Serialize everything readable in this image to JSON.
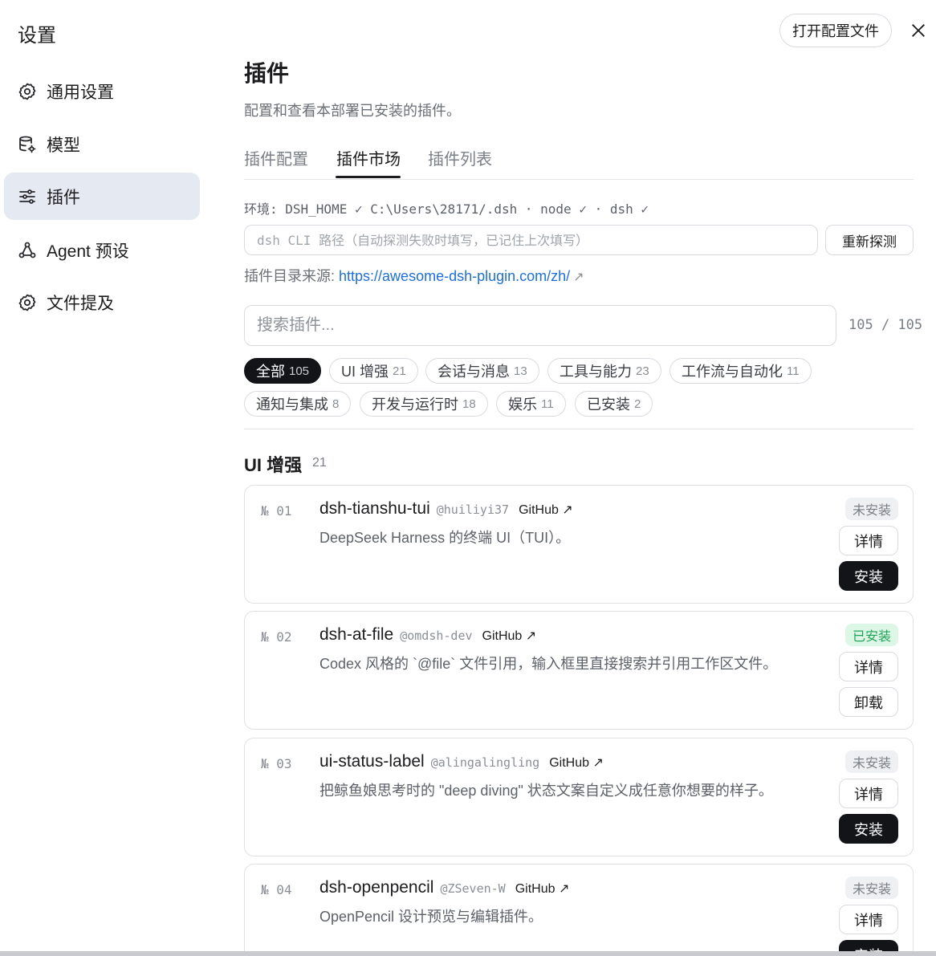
{
  "sidebar": {
    "title": "设置",
    "items": [
      {
        "label": "通用设置",
        "icon": "gear-icon"
      },
      {
        "label": "模型",
        "icon": "database-gear-icon"
      },
      {
        "label": "插件",
        "icon": "sliders-icon",
        "active": true
      },
      {
        "label": "Agent 预设",
        "icon": "network-icon"
      },
      {
        "label": "文件提及",
        "icon": "gear-icon"
      }
    ]
  },
  "header": {
    "open_config_label": "打开配置文件",
    "close_icon": "close-icon"
  },
  "page": {
    "title": "插件",
    "subtitle": "配置和查看本部署已安装的插件。"
  },
  "tabs": [
    {
      "label": "插件配置"
    },
    {
      "label": "插件市场",
      "active": true
    },
    {
      "label": "插件列表"
    }
  ],
  "env": {
    "line": "环境: DSH_HOME ✓ C:\\Users\\28171/.dsh · node ✓ · dsh ✓",
    "cli_placeholder": "dsh CLI 路径（自动探测失败时填写，已记住上次填写）",
    "redetect_label": "重新探测",
    "source_label": "插件目录来源: ",
    "source_url": "https://awesome-dsh-plugin.com/zh/",
    "source_arrow": "↗"
  },
  "search": {
    "placeholder": "搜索插件...",
    "count": "105 / 105"
  },
  "filters": [
    {
      "label": "全部",
      "count": "105",
      "active": true
    },
    {
      "label": "UI 增强",
      "count": "21"
    },
    {
      "label": "会话与消息",
      "count": "13"
    },
    {
      "label": "工具与能力",
      "count": "23"
    },
    {
      "label": "工作流与自动化",
      "count": "11"
    },
    {
      "label": "通知与集成",
      "count": "8"
    },
    {
      "label": "开发与运行时",
      "count": "18"
    },
    {
      "label": "娱乐",
      "count": "11"
    },
    {
      "label": "已安装",
      "count": "2"
    }
  ],
  "section": {
    "title": "UI 增强",
    "count": "21"
  },
  "plugins": [
    {
      "num": "№ 01",
      "name": "dsh-tianshu-tui",
      "author": "@huiliyi37",
      "github": "GitHub ↗",
      "desc": "DeepSeek Harness 的终端 UI（TUI）。",
      "status": "未安装",
      "details": "详情",
      "action": "安装",
      "installed": false
    },
    {
      "num": "№ 02",
      "name": "dsh-at-file",
      "author": "@omdsh-dev",
      "github": "GitHub ↗",
      "desc": "Codex 风格的 `@file` 文件引用，输入框里直接搜索并引用工作区文件。",
      "status": "已安装",
      "details": "详情",
      "action": "卸载",
      "installed": true
    },
    {
      "num": "№ 03",
      "name": "ui-status-label",
      "author": "@alingalingling",
      "github": "GitHub ↗",
      "desc": "把鲸鱼娘思考时的 \"deep diving\" 状态文案自定义成任意你想要的样子。",
      "status": "未安装",
      "details": "详情",
      "action": "安装",
      "installed": false
    },
    {
      "num": "№ 04",
      "name": "dsh-openpencil",
      "author": "@ZSeven-W",
      "github": "GitHub ↗",
      "desc": "OpenPencil 设计预览与编辑插件。",
      "status": "未安装",
      "details": "详情",
      "action": "安装",
      "installed": false
    }
  ]
}
